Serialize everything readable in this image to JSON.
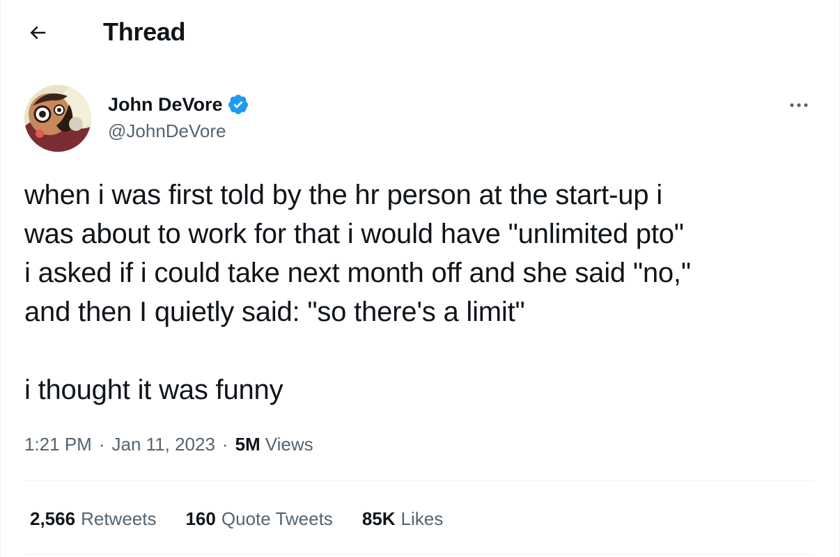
{
  "header": {
    "back_icon": "arrow-left-icon",
    "title": "Thread"
  },
  "author": {
    "avatar_icon": "avatar",
    "display_name": "John DeVore",
    "verified_icon": "verified-badge-icon",
    "handle": "@JohnDeVore",
    "more_icon": "more-horizontal-icon"
  },
  "tweet": {
    "text": "when i was first told by the hr person at the start-up i\nwas about to work for that i would have \"unlimited pto\"\ni asked if i could take next month off and she said \"no,\"\nand then I quietly said: \"so there's a limit\"\n\ni thought it was funny"
  },
  "meta": {
    "time": "1:21 PM",
    "separator": "·",
    "date": "Jan 11, 2023",
    "views_count": "5M",
    "views_label": "Views"
  },
  "stats": {
    "retweets_count": "2,566",
    "retweets_label": "Retweets",
    "quotes_count": "160",
    "quotes_label": "Quote Tweets",
    "likes_count": "85K",
    "likes_label": "Likes"
  },
  "colors": {
    "text_primary": "#0f1419",
    "text_secondary": "#536471",
    "verified_blue": "#1d9bf0",
    "divider": "#eff3f4"
  }
}
